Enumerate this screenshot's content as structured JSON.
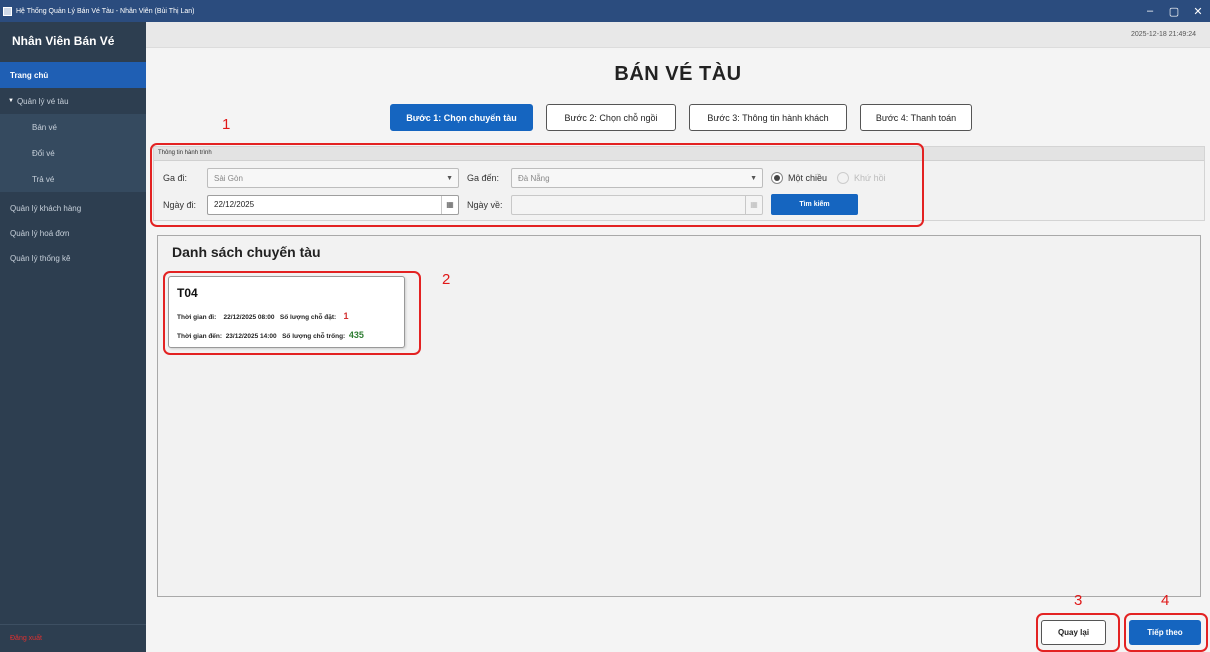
{
  "window": {
    "title": "Hệ Thống Quản Lý Bán Vé Tàu - Nhân Viên (Bùi Thị Lan)",
    "controls": [
      "–",
      "▢",
      "✕"
    ]
  },
  "sidebar": {
    "brand": "Nhân Viên Bán Vé",
    "home": "Trang chủ",
    "group": "Quản lý vé tàu",
    "sub_items": [
      "Bán vé",
      "Đổi vé",
      "Trả vé"
    ],
    "top_items": [
      "Quản lý khách hàng",
      "Quản lý hoá đơn",
      "Quản lý thống kê"
    ],
    "logout": "Đăng xuất"
  },
  "clock": "2025-12-18 21:49:24",
  "page_title": "BÁN VÉ TÀU",
  "steps": [
    {
      "label": "Bước 1: Chọn chuyến tàu",
      "active": true
    },
    {
      "label": "Bước 2: Chọn chỗ ngồi",
      "active": false
    },
    {
      "label": "Bước 3: Thông tin hành khách",
      "active": false
    },
    {
      "label": "Bước 4: Thanh toán",
      "active": false
    }
  ],
  "annotations": [
    "1",
    "2",
    "3",
    "4"
  ],
  "itinerary": {
    "header": "Thông tin hành trình",
    "from_label": "Ga đi:",
    "from_value": "Sài Gòn",
    "to_label": "Ga đến:",
    "to_value": "Đà Nẵng",
    "one_way": "Một chiều",
    "round_trip": "Khứ hồi",
    "depart_label": "Ngày đi:",
    "depart_value": "22/12/2025",
    "return_label": "Ngày về:",
    "return_value": "",
    "search": "Tìm kiếm"
  },
  "train_list": {
    "title": "Danh sách chuyến tàu",
    "trains": [
      {
        "code": "T04",
        "depart_label": "Thời gian đi:",
        "depart_time": "22/12/2025 08:00",
        "booked_label": "Số lượng chỗ đặt:",
        "booked": "1",
        "arrive_label": "Thời gian đến:",
        "arrive_time": "23/12/2025 14:00",
        "free_label": "Số lượng chỗ trống:",
        "free": "435"
      }
    ]
  },
  "actions": {
    "back": "Quay lại",
    "next": "Tiếp theo"
  },
  "colors": {
    "sidebar": "#2d3e50",
    "accent": "#1565c0",
    "annotation": "#e32222",
    "booked": "#d32f2f",
    "free": "#2e7d32"
  }
}
